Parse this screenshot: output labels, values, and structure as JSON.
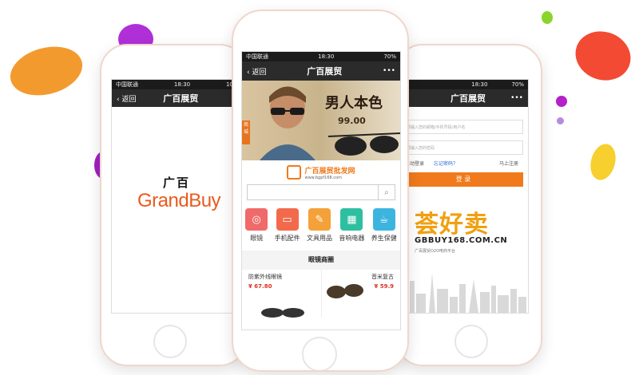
{
  "left_phone": {
    "status": {
      "carrier": "中国联通",
      "time": "18:30",
      "battery": "100%"
    },
    "nav": {
      "back": "返回",
      "title": "广百展贸"
    },
    "logo_cn": "广百",
    "logo_en": "GrandBuy"
  },
  "center_phone": {
    "status": {
      "carrier": "中国联通",
      "time": "18:30",
      "battery": "70%"
    },
    "nav": {
      "back": "返回",
      "title": "广百展贸",
      "more": "•••"
    },
    "banner": {
      "headline": "男人本色",
      "price": "99.00",
      "tag": "商城"
    },
    "site_logo": {
      "cn": "广百展贸批发网",
      "url": "www.bgpf168.com"
    },
    "search": {
      "placeholder": ""
    },
    "categories": [
      {
        "label": "眼镜",
        "color": "#f06a6a",
        "icon": "glasses-icon",
        "glyph": "◎"
      },
      {
        "label": "手机配件",
        "color": "#f26a4b",
        "icon": "laptop-icon",
        "glyph": "▭"
      },
      {
        "label": "文具用品",
        "color": "#f5a13a",
        "icon": "pencil-icon",
        "glyph": "✎"
      },
      {
        "label": "音响电器",
        "color": "#2ebfa0",
        "icon": "radio-icon",
        "glyph": "▦"
      },
      {
        "label": "养生保健",
        "color": "#3cb4e0",
        "icon": "cup-icon",
        "glyph": "☕"
      }
    ],
    "section_title": "眼镜商圈",
    "products": [
      {
        "name": "防紫外线眼镜",
        "price": "¥ 67.80"
      },
      {
        "name": "音米复古",
        "price": "¥ 59.9"
      }
    ]
  },
  "right_phone": {
    "status": {
      "time": "18:30",
      "battery": "70%"
    },
    "nav": {
      "title": "广百展贸",
      "more": "•••"
    },
    "username_placeholder": "请输入您的邮箱/手机号码/用户名",
    "password_placeholder": "请输入您的密码",
    "auto_login": "自动登录",
    "forgot": "忘记密码？",
    "register": "马上注册",
    "login_button": "登 录",
    "brand_cn": "荟好卖",
    "brand_url": "GBBUY168.COM.CN",
    "brand_sub": "广百展贸O2O电商平台"
  }
}
